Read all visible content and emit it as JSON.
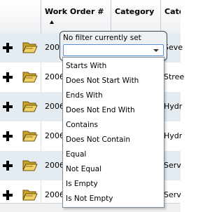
{
  "grid": {
    "columns": [
      {
        "label": ""
      },
      {
        "label": "Work Order #"
      },
      {
        "label": "Category"
      },
      {
        "label": "Cate"
      }
    ],
    "rows": [
      {
        "work_order": "2006",
        "category_desc": "Seve"
      },
      {
        "work_order": "2006",
        "category_desc": "Stree"
      },
      {
        "work_order": "2006",
        "category_desc": "Hydr"
      },
      {
        "work_order": "2006",
        "category_desc": "Hydr"
      },
      {
        "work_order": "2006",
        "category_desc": "Serv"
      },
      {
        "work_order": "2006",
        "category_desc": "Serv"
      }
    ],
    "sort": "ascending"
  },
  "filter": {
    "status_label": "No filter currently set",
    "selected_value": "",
    "options": [
      "Starts With",
      "Does Not Start With",
      "Ends With",
      "Does Not End With",
      "Contains",
      "Does Not Contain",
      "Equal",
      "Not Equal",
      "Is Empty",
      "Is Not Empty"
    ]
  },
  "colors": {
    "row_alt": "#e4ebf1",
    "header_border": "#c5cbd1",
    "popup_border": "#3b4856",
    "select_border": "#5b8fd6"
  },
  "icons": {
    "expand": "plus-icon",
    "open": "open-folder-icon"
  }
}
